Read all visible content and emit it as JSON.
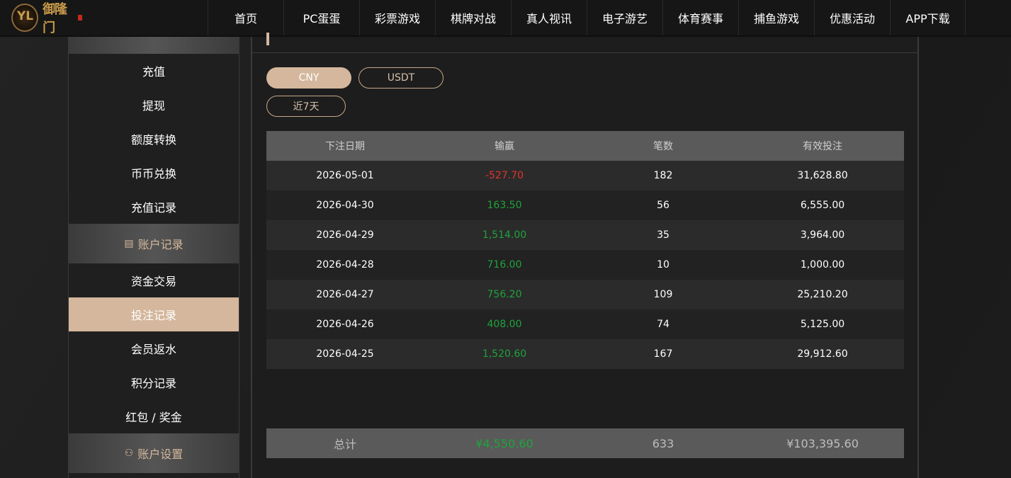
{
  "brand": {
    "name": "御隆门",
    "mark": "YL"
  },
  "nav": [
    {
      "label": "首页"
    },
    {
      "label": "PC蛋蛋"
    },
    {
      "label": "彩票游戏"
    },
    {
      "label": "棋牌对战"
    },
    {
      "label": "真人视讯"
    },
    {
      "label": "电子游艺"
    },
    {
      "label": "体育赛事"
    },
    {
      "label": "捕鱼游戏"
    },
    {
      "label": "优惠活动"
    },
    {
      "label": "APP下载"
    }
  ],
  "sidebar": {
    "top_items": [
      {
        "label": "充值"
      },
      {
        "label": "提现"
      },
      {
        "label": "额度转换"
      },
      {
        "label": "币币兑换"
      },
      {
        "label": "充值记录"
      }
    ],
    "records_section": {
      "label": "账户记录",
      "icon": "record-icon"
    },
    "record_items": [
      {
        "label": "资金交易"
      },
      {
        "label": "投注记录"
      },
      {
        "label": "会员返水"
      },
      {
        "label": "积分记录"
      },
      {
        "label": "红包 / 奖金"
      }
    ],
    "settings_section": {
      "label": "账户设置",
      "icon": "user-settings-icon"
    }
  },
  "filters": {
    "currencies": [
      {
        "label": "CNY",
        "active": true
      },
      {
        "label": "USDT",
        "active": false
      }
    ],
    "period": "近7天"
  },
  "table": {
    "columns": [
      "下注日期",
      "输赢",
      "笔数",
      "有效投注"
    ],
    "rows": [
      {
        "date": "2026-05-01",
        "winloss": "-527.70",
        "count": "182",
        "valid": "31,628.80"
      },
      {
        "date": "2026-04-30",
        "winloss": "163.50",
        "count": "56",
        "valid": "6,555.00"
      },
      {
        "date": "2026-04-29",
        "winloss": "1,514.00",
        "count": "35",
        "valid": "3,964.00"
      },
      {
        "date": "2026-04-28",
        "winloss": "716.00",
        "count": "10",
        "valid": "1,000.00"
      },
      {
        "date": "2026-04-27",
        "winloss": "756.20",
        "count": "109",
        "valid": "25,210.20"
      },
      {
        "date": "2026-04-26",
        "winloss": "408.00",
        "count": "74",
        "valid": "5,125.00"
      },
      {
        "date": "2026-04-25",
        "winloss": "1,520.60",
        "count": "167",
        "valid": "29,912.60"
      }
    ],
    "total": {
      "label": "总计",
      "winloss": "¥4,550.60",
      "count": "633",
      "valid": "¥103,395.60"
    }
  },
  "colors": {
    "accent": "#d4b79c",
    "negative": "#e0342e",
    "positive": "#1fa33c"
  }
}
